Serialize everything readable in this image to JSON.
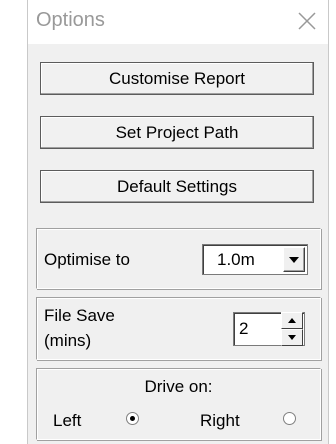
{
  "window": {
    "title": "Options"
  },
  "buttons": {
    "customise_report": "Customise Report",
    "set_project_path": "Set Project Path",
    "default_settings": "Default Settings"
  },
  "optimise": {
    "label": "Optimise to",
    "value": "1.0m"
  },
  "file_save": {
    "label_line1": "File Save",
    "label_line2": "(mins)",
    "value": "2"
  },
  "drive_on": {
    "label": "Drive on:",
    "left_label": "Left",
    "right_label": "Right",
    "selected": "Left"
  },
  "icons": {
    "close": "close-icon",
    "dropdown": "chevron-down-icon",
    "spin_up": "spin-up-icon",
    "spin_down": "spin-down-icon"
  }
}
